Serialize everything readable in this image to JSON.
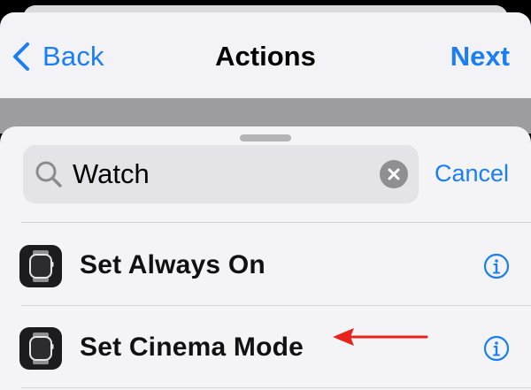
{
  "nav": {
    "back_label": "Back",
    "title": "Actions",
    "next_label": "Next"
  },
  "search": {
    "value": "Watch",
    "cancel_label": "Cancel"
  },
  "actions": [
    {
      "label": "Set Always On",
      "icon": "apple-watch-icon"
    },
    {
      "label": "Set Cinema Mode",
      "icon": "apple-watch-icon"
    }
  ],
  "colors": {
    "accent": "#1a7ef5",
    "annotation_arrow": "#e8231b",
    "sheet_background": "#f4f4f6",
    "search_field": "#e3e3e8"
  }
}
